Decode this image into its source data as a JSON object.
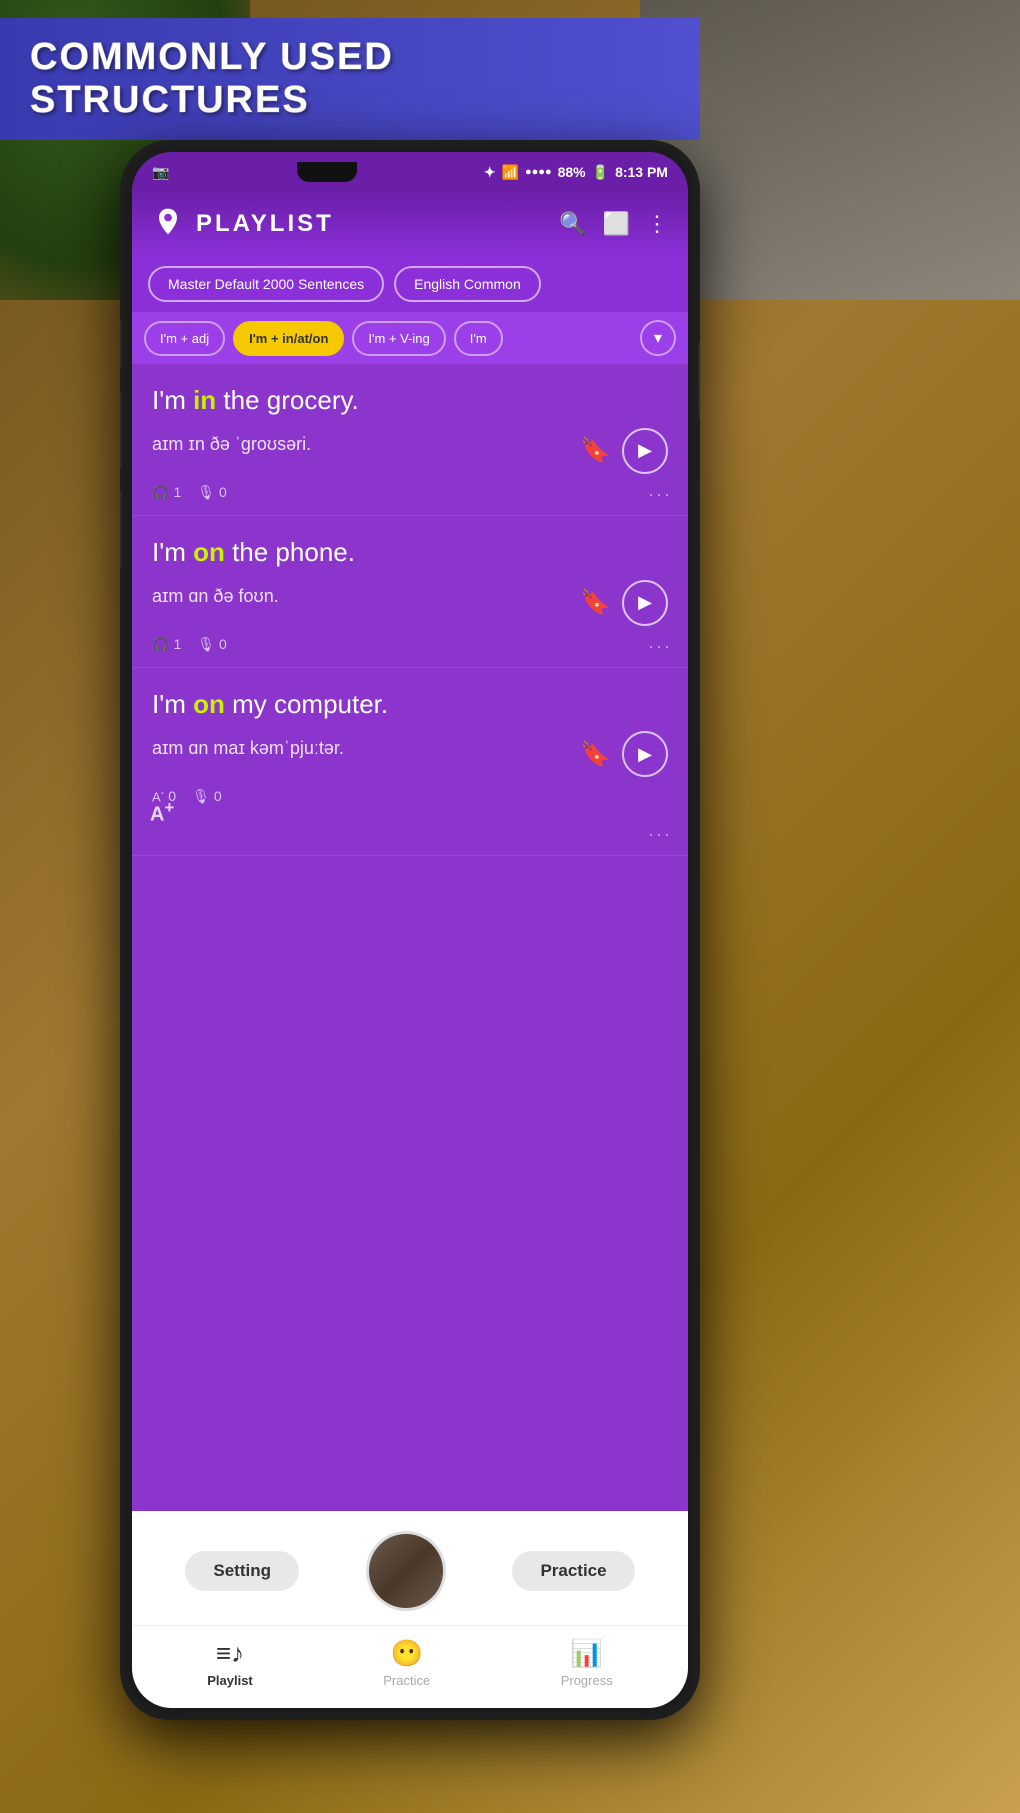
{
  "banner": {
    "text": "COMMONLY USED STRUCTURES"
  },
  "status_bar": {
    "time": "8:13 PM",
    "battery": "88%",
    "signal": "●●●●"
  },
  "app": {
    "title": "PLAYLIST",
    "search_icon": "search-icon",
    "expand_icon": "expand-icon",
    "more_icon": "more-icon"
  },
  "playlist_tabs": [
    {
      "label": "Master Default 2000 Sentences",
      "active": false
    },
    {
      "label": "English Common",
      "active": false
    }
  ],
  "filter_tabs": [
    {
      "label": "I'm + adj",
      "active": false
    },
    {
      "label": "I'm + in/at/on",
      "active": true
    },
    {
      "label": "I'm + V-ing",
      "active": false
    },
    {
      "label": "I'm",
      "active": false
    }
  ],
  "sentences": [
    {
      "id": 1,
      "text_prefix": "I'm ",
      "text_highlight": "in",
      "text_suffix": " the grocery.",
      "phonetic": "aɪm ɪn ðə ˈɡroʊsəri.",
      "listen_count": 1,
      "practice_count": 0,
      "bookmarked": true
    },
    {
      "id": 2,
      "text_prefix": "I'm ",
      "text_highlight": "on",
      "text_suffix": " the phone.",
      "phonetic": "aɪm ɑn ðə foʊn.",
      "listen_count": 1,
      "practice_count": 0,
      "bookmarked": true
    },
    {
      "id": 3,
      "text_prefix": "I'm ",
      "text_highlight": "on",
      "text_suffix": " my computer.",
      "phonetic": "aɪm ɑn maɪ kəmˈpjuːtər.",
      "listen_count": 0,
      "practice_count": 0,
      "bookmarked": true
    }
  ],
  "bottom": {
    "setting_label": "Setting",
    "practice_label": "Practice"
  },
  "nav": [
    {
      "label": "Playlist",
      "icon": "playlist-icon",
      "active": true
    },
    {
      "label": "Practice",
      "icon": "practice-icon",
      "active": false
    },
    {
      "label": "Progress",
      "icon": "progress-icon",
      "active": false
    }
  ]
}
